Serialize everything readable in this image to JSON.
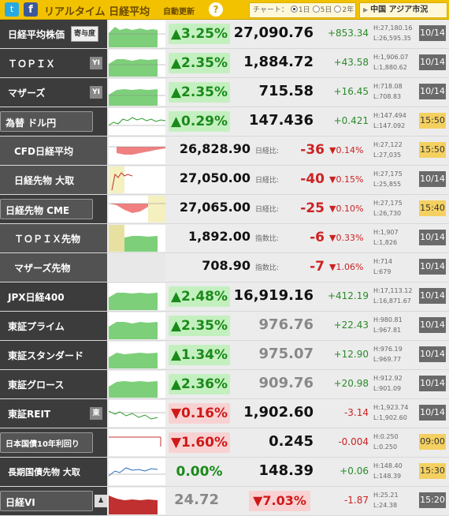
{
  "header": {
    "title": "リアルタイム 日経平均",
    "subtitle": "自動更新",
    "help": "?",
    "chart_label": "チャート：",
    "chart_options": [
      "1日",
      "5日",
      "2年"
    ],
    "china_link": "中国 アジア市況"
  },
  "rows": [
    {
      "name": "日経平均株価",
      "button": "寄与度",
      "pct": "▲3.25%",
      "price": "27,090.76",
      "change": "+853.34",
      "high": "H:27,180.16",
      "low": "L:26,595.35",
      "date": "10/14"
    },
    {
      "name": "ＴＯＰＩＸ",
      "button": "YI",
      "pct": "▲2.35%",
      "price": "1,884.72",
      "change": "+43.58",
      "high": "H:1,906.07",
      "low": "L:1,880.62",
      "date": "10/14"
    },
    {
      "name": "マザーズ",
      "button": "YI",
      "pct": "▲2.35%",
      "price": "715.58",
      "change": "+16.45",
      "high": "H:718.08",
      "low": "L:708.83",
      "date": "10/14"
    },
    {
      "name": "為替 ドル円",
      "pct": "▲0.29%",
      "price": "147.436",
      "change": "+0.421",
      "high": "H:147.494",
      "low": "L:147.092",
      "date": "15:50"
    },
    {
      "name": "CFD日経平均",
      "price": "26,828.90",
      "label": "日経比:",
      "diff": "-36",
      "pct2": "▼0.14%",
      "high": "H:27,122",
      "low": "L:27,035",
      "date": "15:50"
    },
    {
      "name": "日経先物 大取",
      "price": "27,050.00",
      "label": "日経比:",
      "diff": "-40",
      "pct2": "▼0.15%",
      "high": "H:27,175",
      "low": "L:25,855",
      "date": "10/14"
    },
    {
      "name": "日経先物 CME",
      "price": "27,065.00",
      "label": "日経比:",
      "diff": "-25",
      "pct2": "▼0.10%",
      "high": "H:27,175",
      "low": "L:26,730",
      "date": "15:40"
    },
    {
      "name": "ＴＯＰＩＸ先物",
      "price": "1,892.00",
      "label": "指数比:",
      "diff": "-6",
      "pct2": "▼0.33%",
      "high": "H:1,907",
      "low": "L:1,826",
      "date": "10/14"
    },
    {
      "name": "マザーズ先物",
      "price": "708.90",
      "label": "指数比:",
      "diff": "-7",
      "pct2": "▼1.06%",
      "high": "H:714",
      "low": "L:679",
      "date": "10/14"
    },
    {
      "name": "JPX日経400",
      "pct": "▲2.48%",
      "price": "16,919.16",
      "change": "+412.19",
      "high": "H:17,113.12",
      "low": "L:16,871.67",
      "date": "10/14"
    },
    {
      "name": "東証プライム",
      "pct": "▲2.35%",
      "price": "976.76",
      "change": "+22.43",
      "high": "H:980.81",
      "low": "L:967.81",
      "date": "10/14"
    },
    {
      "name": "東証スタンダード",
      "pct": "▲1.34%",
      "price": "975.07",
      "change": "+12.90",
      "high": "H:976.19",
      "low": "L:969.77",
      "date": "10/14"
    },
    {
      "name": "東証グロース",
      "pct": "▲2.36%",
      "price": "909.76",
      "change": "+20.98",
      "high": "H:912.92",
      "low": "L:901.09",
      "date": "10/14"
    },
    {
      "name": "東証REIT",
      "button": "東",
      "pct": "▼0.16%",
      "price": "1,902.60",
      "change": "-3.14",
      "high": "H:1,923.74",
      "low": "L:1,902.60",
      "date": "10/14"
    },
    {
      "name": "日本国債10年利回り",
      "pct": "▼1.60%",
      "price": "0.245",
      "change": "-0.004",
      "high": "H:0.250",
      "low": "L:0.250",
      "date": "09:00"
    },
    {
      "name": "長期国債先物 大取",
      "pct": "0.00%",
      "price": "148.39",
      "change": "+0.06",
      "high": "H:148.40",
      "low": "L:148.39",
      "date": "15:30"
    },
    {
      "name": "日経VI",
      "price": "24.72",
      "pct": "▼7.03%",
      "change": "-1.87",
      "high": "H:25.21",
      "low": "L:24.38",
      "date": "15:20"
    }
  ],
  "colors": {
    "header_bg": "#f2c200",
    "up_bg": "#c4f0c0",
    "down_bg": "#f8d2d2",
    "up_text": "#1a8a1a",
    "down_text": "#cc2222"
  }
}
